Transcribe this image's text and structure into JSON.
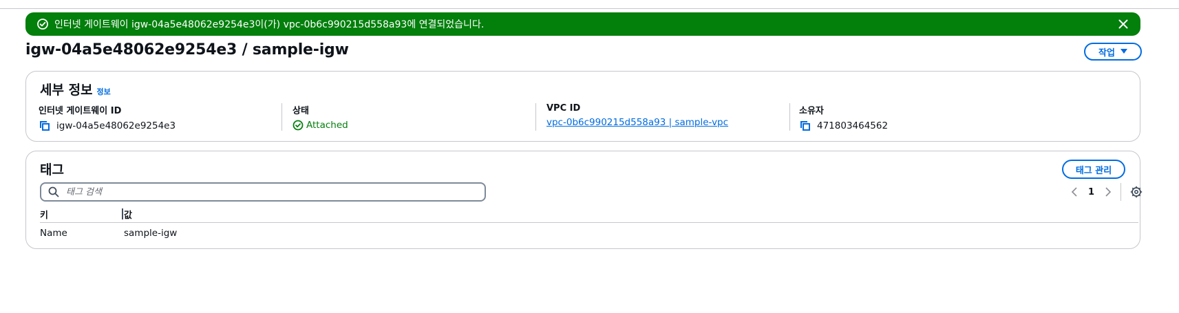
{
  "flash": {
    "message": "인터넷 게이트웨이 igw-04a5e48062e9254e3이(가) vpc-0b6c990215d558a93에 연결되었습니다.",
    "type": "success",
    "color": "#037f0c"
  },
  "header": {
    "title": "igw-04a5e48062e9254e3 / sample-igw",
    "actions_label": "작업"
  },
  "details": {
    "title": "세부 정보",
    "info_link": "정보",
    "fields": [
      {
        "label": "인터넷 게이트웨이 ID",
        "value": "igw-04a5e48062e9254e3",
        "icon": "copy-icon"
      },
      {
        "label": "상태",
        "value": "Attached",
        "icon": "status-positive-icon"
      },
      {
        "label": "VPC ID",
        "value": "vpc-0b6c990215d558a93 | sample-vpc"
      },
      {
        "label": "소유자",
        "value": "471803464562",
        "icon": "copy-icon"
      }
    ]
  },
  "tags": {
    "title": "태그",
    "manage_label": "태그 관리",
    "search_placeholder": "태그 검색",
    "page": "1",
    "columns": [
      "키",
      "값"
    ],
    "rows": [
      {
        "key": "Name",
        "value": "sample-igw"
      }
    ]
  },
  "colors": {
    "accent": "#006ce0",
    "success": "#037f0c",
    "border": "#c6c6cd"
  }
}
